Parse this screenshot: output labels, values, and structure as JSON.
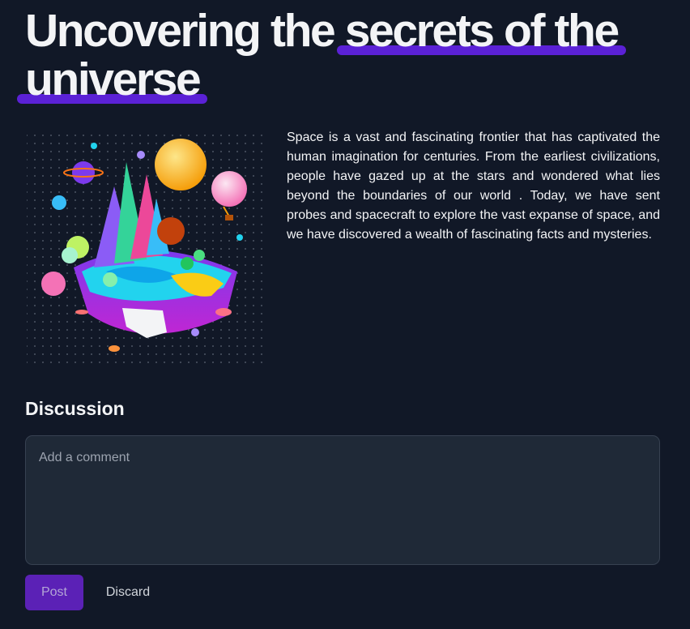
{
  "article": {
    "title_part1": "Uncovering the ",
    "title_highlight1": "secrets of the",
    "title_highlight2": "universe",
    "body": "Space is a vast and fascinating frontier that has captivated the human imagination for centuries. From the earliest civilizations, people have gazed up at the stars and wondered what lies beyond the boundaries of our world . Today, we have sent probes and spacecraft to explore the vast expanse of space, and we have discovered a wealth of fascinating facts and mysteries.",
    "image_icon": "floating-planet-island-illustration"
  },
  "discussion": {
    "heading": "Discussion",
    "comment_placeholder": "Add a comment",
    "comment_value": "",
    "post_label": "Post",
    "discard_label": "Discard"
  },
  "colors": {
    "background": "#111827",
    "accent": "#5b21d6",
    "post_button": "#5b21b6",
    "input_background": "#1f2937"
  }
}
